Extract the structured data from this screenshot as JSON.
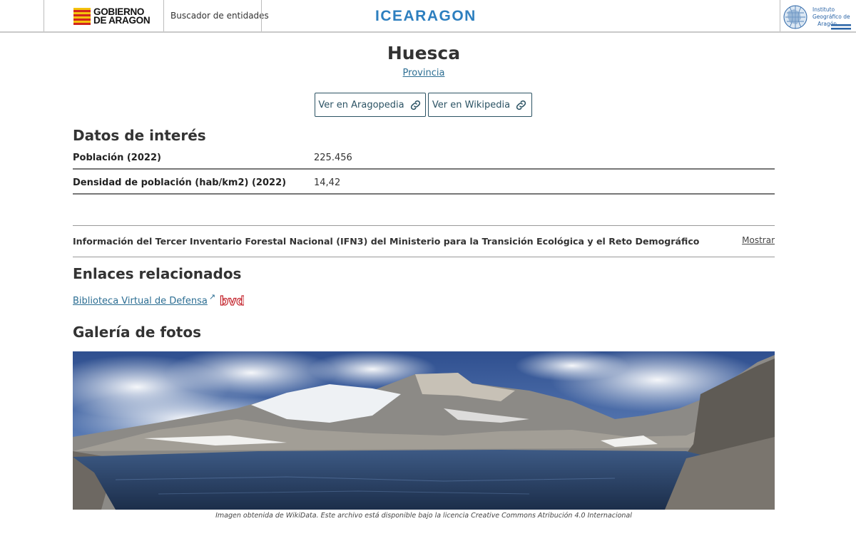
{
  "header": {
    "gov_logo_line1": "GOBIERNO",
    "gov_logo_line2": "DE ARAGON",
    "search_link": "Buscador de entidades",
    "brand": "ICEARAGON",
    "institute_logo": "Instituto Geográfico de Aragón"
  },
  "entity": {
    "title": "Huesca",
    "type": "Provincia"
  },
  "external_links": {
    "aragopedia": "Ver en Aragopedia",
    "wikipedia": "Ver en Wikipedia",
    "icon": "link-icon"
  },
  "datos": {
    "heading": "Datos de interés",
    "rows": [
      {
        "label": "Población (2022)",
        "value": "225.456"
      },
      {
        "label": "Densidad de población (hab/km2) (2022)",
        "value": "14,42"
      }
    ]
  },
  "ifn": {
    "text": "Información del Tercer Inventario Forestal Nacional (IFN3) del Ministerio para la Transición Ecológica y el Reto Demográfico",
    "toggle": "Mostrar"
  },
  "enlaces": {
    "heading": "Enlaces relacionados",
    "items": [
      {
        "label": "Biblioteca Virtual de Defensa",
        "icon": "external-link-icon",
        "logo": "bvd"
      }
    ]
  },
  "galeria": {
    "heading": "Galería de fotos",
    "caption": "Imagen obtenida de WikiData. Este archivo está disponible bajo la licencia Creative Commons Atribución 4.0 Internacional"
  },
  "colors": {
    "brand": "#2d7fbf",
    "link": "#2c6e93",
    "button_border": "#2c5364"
  }
}
